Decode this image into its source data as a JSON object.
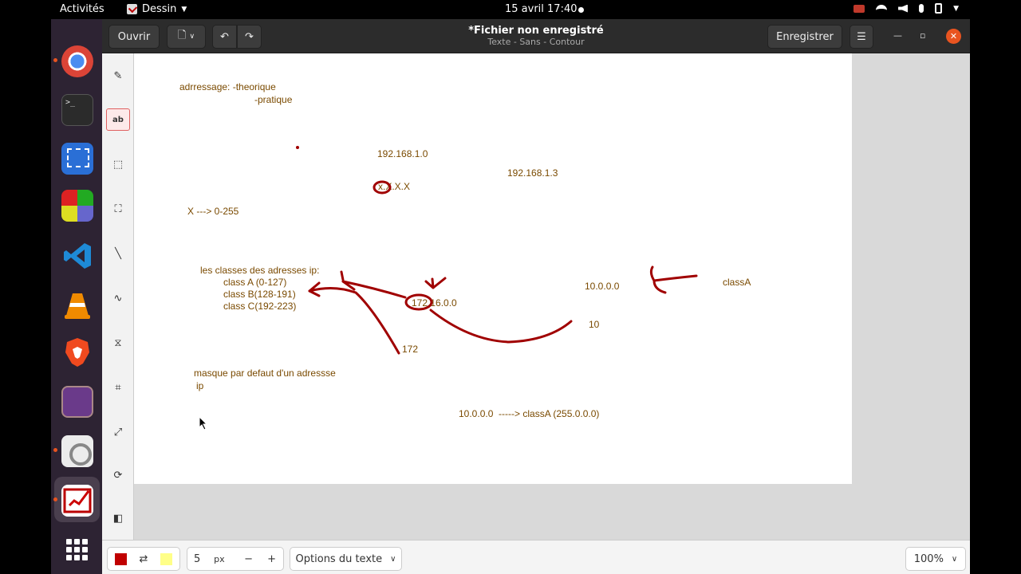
{
  "topbar": {
    "activities": "Activités",
    "app_name": "Dessin",
    "clock": "15 avril  17:40"
  },
  "window": {
    "open_label": "Ouvrir",
    "title": "*Fichier non enregistré",
    "subtitle": "Texte - Sans - Contour",
    "save_label": "Enregistrer"
  },
  "canvas_texts": {
    "adressage_1": "adrressage: -theorique",
    "adressage_2": "-pratique",
    "ip1": "192.168.1.0",
    "ip2": "192.168.1.3",
    "xxxx": "x.X.X.X",
    "range": "X ---> 0-255",
    "classes_title": "les classes des adresses ip:",
    "class_a": "class A (0-127)",
    "class_b": "class B(128-191)",
    "class_c": "class C(192-223)",
    "ip3": "172.16.0.0",
    "ip4": "10.0.0.0",
    "classA": "classA",
    "ten": "10",
    "n172": "172",
    "masque_1": "masque par defaut d'un adressse",
    "masque_2": "ip",
    "mask_line": "10.0.0.0  -----> classA (255.0.0.0)"
  },
  "bottom": {
    "primary_color": "#c00000",
    "secondary_color": "#ffff88",
    "size_value": "5",
    "size_unit": "px",
    "minus": "−",
    "plus": "+",
    "options_label": "Options du texte",
    "zoom": "100%"
  }
}
